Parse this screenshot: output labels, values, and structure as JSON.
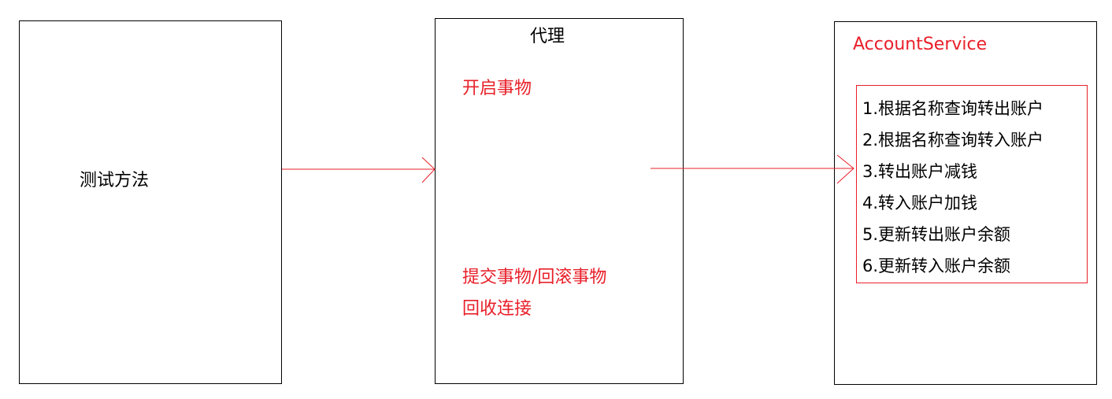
{
  "test_box": {
    "label": "测试方法"
  },
  "proxy_box": {
    "title": "代理",
    "begin": "开启事物",
    "commit_rollback": "提交事物/回滚事物",
    "close": "回收连接"
  },
  "account_box": {
    "title": "AccountService",
    "steps": [
      "1.根据名称查询转出账户",
      "2.根据名称查询转入账户",
      "3.转出账户减钱",
      "4.转入账户加钱",
      "5.更新转出账户余额",
      "6.更新转入账户余额"
    ]
  },
  "colors": {
    "accent": "#e8202a",
    "border": "#000000"
  }
}
